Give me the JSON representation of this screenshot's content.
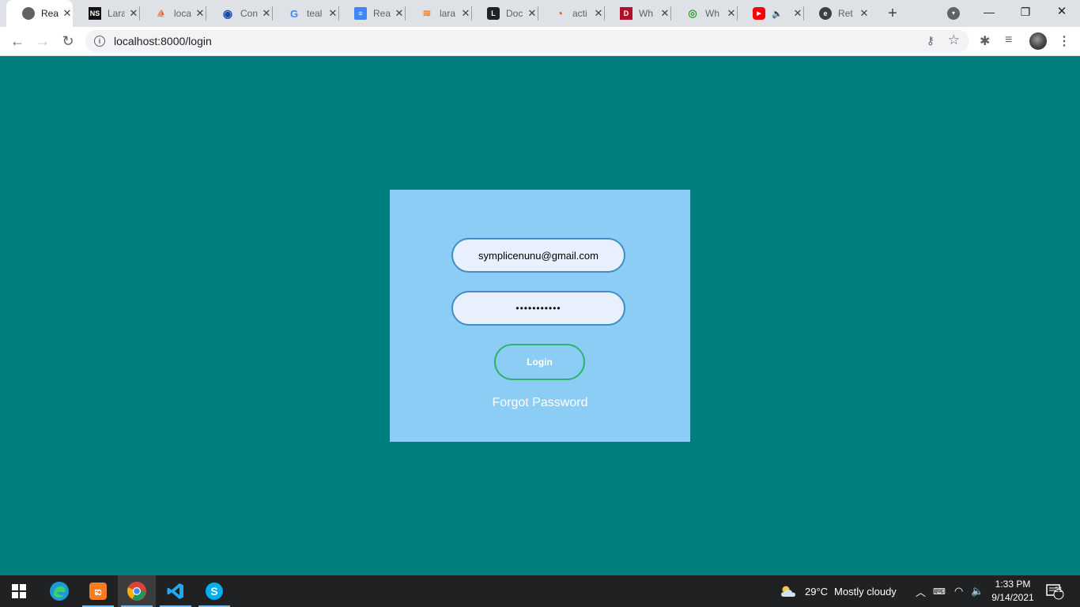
{
  "browser": {
    "tabs": [
      {
        "title": "Real",
        "icon": "globe-icon",
        "fav_glyph": "",
        "active": true
      },
      {
        "title": "Lara",
        "icon": "ns-icon",
        "fav_glyph": "NS"
      },
      {
        "title": "loca",
        "icon": "phpmyadmin-icon",
        "fav_glyph": "⛵"
      },
      {
        "title": "Con",
        "icon": "circle-logo-icon",
        "fav_glyph": "◉"
      },
      {
        "title": "teal",
        "icon": "google-icon",
        "fav_glyph": "G"
      },
      {
        "title": "Real",
        "icon": "docs-icon",
        "fav_glyph": "≡"
      },
      {
        "title": "lara",
        "icon": "stackoverflow-icon",
        "fav_glyph": "≋"
      },
      {
        "title": "Doc",
        "icon": "laravel-doc-icon",
        "fav_glyph": "L"
      },
      {
        "title": "acti",
        "icon": "ubuntu-icon",
        "fav_glyph": "◔"
      },
      {
        "title": "Wh",
        "icon": "d-logo-icon",
        "fav_glyph": "D"
      },
      {
        "title": "Wh",
        "icon": "whatsapp-icon",
        "fav_glyph": "◎"
      },
      {
        "title": "",
        "icon": "youtube-icon",
        "fav_glyph": "▶",
        "audio": "🔈"
      },
      {
        "title": "Ret",
        "icon": "edge-legacy-icon",
        "fav_glyph": "e"
      }
    ],
    "new_tab": "+",
    "window_controls": {
      "minimize": "—",
      "restore": "❐",
      "close": "✕"
    },
    "url": "localhost:8000/login"
  },
  "login": {
    "email_value": "symplicenunu@gmail.com",
    "password_value": "•••••••••••",
    "login_label": "Login",
    "forgot_label": "Forgot Password"
  },
  "taskbar": {
    "weather_temp": "29°C",
    "weather_text": "Mostly cloudy",
    "time": "1:33 PM",
    "date": "9/14/2021",
    "notification_count": "21"
  },
  "colors": {
    "page_background": "#007d7f",
    "card_background": "#8ccdf6",
    "field_border": "#3f8ec9",
    "login_border": "#2fb36a"
  }
}
